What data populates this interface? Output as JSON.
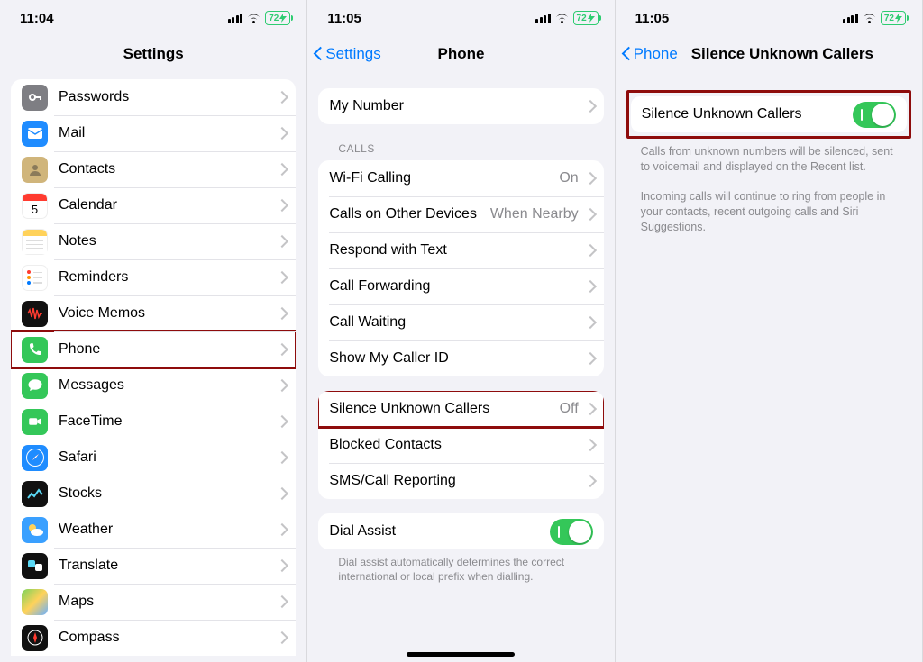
{
  "status": {
    "time1": "11:04",
    "time2": "11:05",
    "time3": "11:05",
    "battery": "72"
  },
  "panel1": {
    "title": "Settings",
    "items": [
      {
        "label": "Passwords"
      },
      {
        "label": "Mail"
      },
      {
        "label": "Contacts"
      },
      {
        "label": "Calendar"
      },
      {
        "label": "Notes"
      },
      {
        "label": "Reminders"
      },
      {
        "label": "Voice Memos"
      },
      {
        "label": "Phone"
      },
      {
        "label": "Messages"
      },
      {
        "label": "FaceTime"
      },
      {
        "label": "Safari"
      },
      {
        "label": "Stocks"
      },
      {
        "label": "Weather"
      },
      {
        "label": "Translate"
      },
      {
        "label": "Maps"
      },
      {
        "label": "Compass"
      }
    ]
  },
  "panel2": {
    "back": "Settings",
    "title": "Phone",
    "my_number": "My Number",
    "calls_header": "CALLS",
    "items1": [
      {
        "label": "Wi-Fi Calling",
        "detail": "On"
      },
      {
        "label": "Calls on Other Devices",
        "detail": "When Nearby"
      },
      {
        "label": "Respond with Text",
        "detail": ""
      },
      {
        "label": "Call Forwarding",
        "detail": ""
      },
      {
        "label": "Call Waiting",
        "detail": ""
      },
      {
        "label": "Show My Caller ID",
        "detail": ""
      }
    ],
    "items2": [
      {
        "label": "Silence Unknown Callers",
        "detail": "Off"
      },
      {
        "label": "Blocked Contacts",
        "detail": ""
      },
      {
        "label": "SMS/Call Reporting",
        "detail": ""
      }
    ],
    "dial_assist": "Dial Assist",
    "dial_footer": "Dial assist automatically determines the correct international or local prefix when dialling."
  },
  "panel3": {
    "back": "Phone",
    "title": "Silence Unknown Callers",
    "toggle_label": "Silence Unknown Callers",
    "footer1": "Calls from unknown numbers will be silenced, sent to voicemail and displayed on the Recent list.",
    "footer2": "Incoming calls will continue to ring from people in your contacts, recent outgoing calls and Siri Suggestions."
  }
}
